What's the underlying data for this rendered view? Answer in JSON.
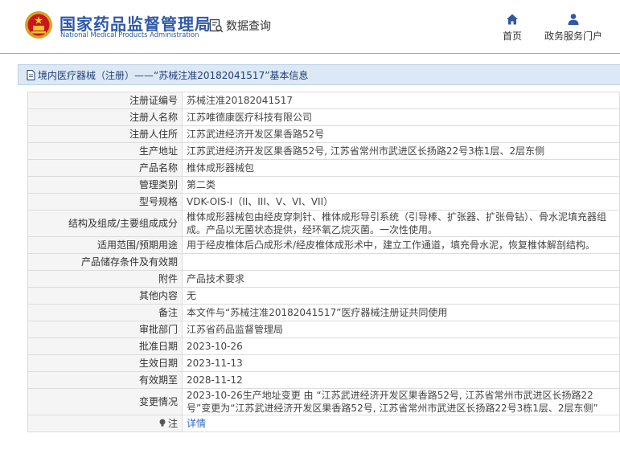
{
  "header": {
    "logo_cn": "国家药品监督管理局",
    "logo_en": "National Medical Products Administration",
    "query_label": "数据查询",
    "nav": [
      {
        "label": "首页",
        "icon": "home-icon"
      },
      {
        "label": "政务服务门户",
        "icon": "user-icon"
      }
    ]
  },
  "breadcrumb": {
    "text": "境内医疗器械（注册）——“苏械注准20182041517”基本信息"
  },
  "rows": [
    {
      "label": "注册证编号",
      "value": "苏械注准20182041517"
    },
    {
      "label": "注册人名称",
      "value": "江苏唯德康医疗科技有限公司"
    },
    {
      "label": "注册人住所",
      "value": "江苏武进经济开发区果香路52号"
    },
    {
      "label": "生产地址",
      "value": "江苏武进经济开发区果香路52号, 江苏省常州市武进区长扬路22号3栋1层、2层东侧"
    },
    {
      "label": "产品名称",
      "value": "椎体成形器械包"
    },
    {
      "label": "管理类别",
      "value": "第二类"
    },
    {
      "label": "型号规格",
      "value": "VDK-OIS-I（II、III、V、VI、VII）"
    },
    {
      "label": "结构及组成/主要组成成分",
      "value": "椎体成形器械包由经皮穿刺针、椎体成形导引系统（引导棒、扩张器、扩张骨钻）、骨水泥填充器组成。产品以无菌状态提供，经环氧乙烷灭菌。一次性使用。"
    },
    {
      "label": "适用范围/预期用途",
      "value": "用于经皮椎体后凸成形术/经皮椎体成形术中，建立工作通道，填充骨水泥，恢复椎体解剖结构。"
    },
    {
      "label": "产品储存条件及有效期",
      "value": ""
    },
    {
      "label": "附件",
      "value": "产品技术要求"
    },
    {
      "label": "其他内容",
      "value": "无"
    },
    {
      "label": "备注",
      "value": "本文件与“苏械注准20182041517”医疗器械注册证共同使用"
    },
    {
      "label": "审批部门",
      "value": "江苏省药品监督管理局"
    },
    {
      "label": "批准日期",
      "value": "2023-10-26"
    },
    {
      "label": "生效日期",
      "value": "2023-11-13"
    },
    {
      "label": "有效期至",
      "value": "2028-11-12"
    },
    {
      "label": "变更情况",
      "value": "2023-10-26生产地址变更 由 “江苏武进经济开发区果香路52号, 江苏省常州市武进区长扬路22号”变更为“江苏武进经济开发区果香路52号, 江苏省常州市武进区长扬路22号3栋1层、2层东侧”"
    },
    {
      "label": "注",
      "value": "详情",
      "icon": "bulb-icon"
    }
  ],
  "colors": {
    "brand": "#2e59a7",
    "title_bg": "#dde8f5",
    "link": "#2e6bc2"
  }
}
